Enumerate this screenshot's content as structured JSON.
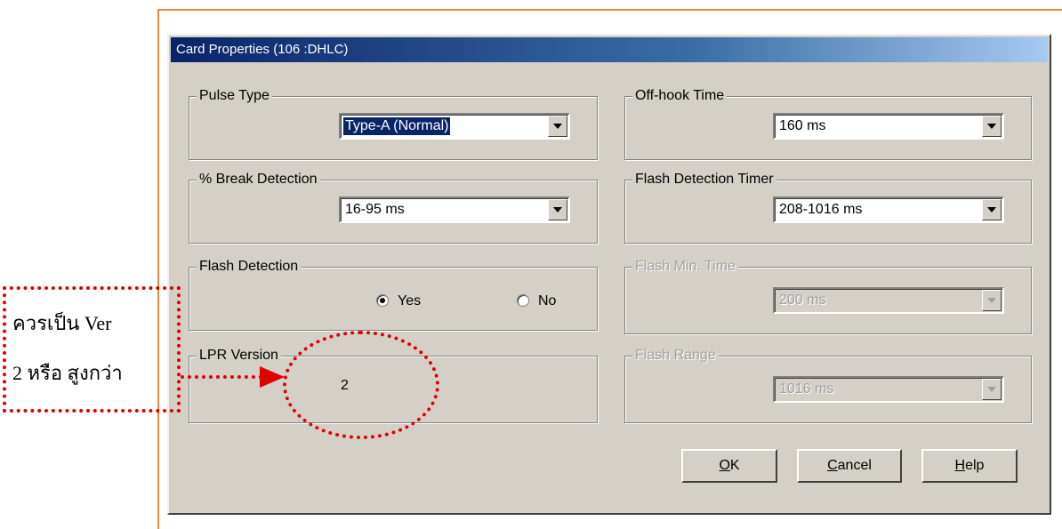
{
  "dialog": {
    "title": "Card Properties (106 :DHLC)"
  },
  "pulse_type": {
    "label": "Pulse Type",
    "value": "Type-A (Normal)"
  },
  "break_detection": {
    "label": "% Break Detection",
    "value": "16-95 ms"
  },
  "flash_detection": {
    "label": "Flash Detection",
    "yes_label": "Yes",
    "no_label": "No",
    "selected": "Yes"
  },
  "lpr_version": {
    "label": "LPR Version",
    "value": "2"
  },
  "off_hook_time": {
    "label": "Off-hook Time",
    "value": "160 ms"
  },
  "flash_detection_timer": {
    "label": "Flash Detection Timer",
    "value": "208-1016 ms"
  },
  "flash_min_time": {
    "label": "Flash Min. Time",
    "value": "200 ms",
    "enabled": false
  },
  "flash_range": {
    "label": "Flash Range",
    "value": "1016 ms",
    "enabled": false
  },
  "buttons": {
    "ok": "OK",
    "cancel": "Cancel",
    "help": "Help"
  },
  "annotation": {
    "line1": "ควรเป็น Ver",
    "line2": "2 หรือ สูงกว่า",
    "color": "#e00000"
  }
}
